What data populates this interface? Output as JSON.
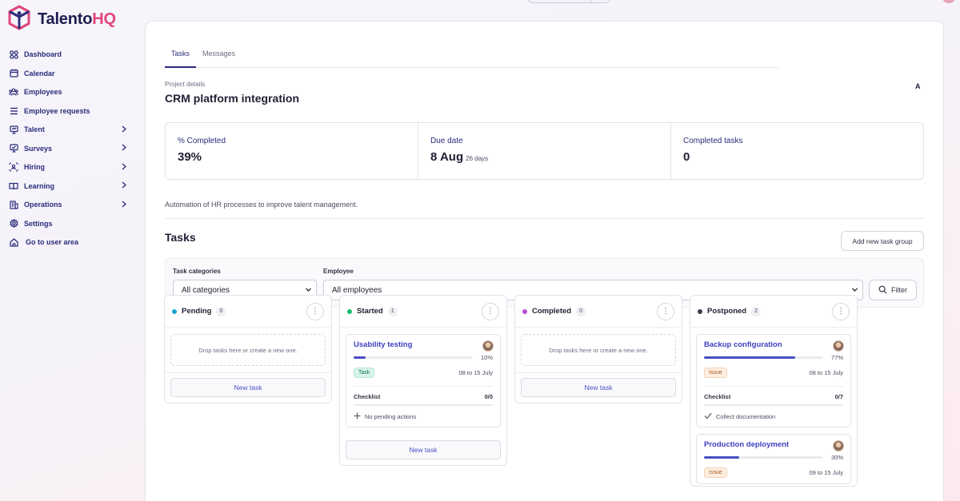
{
  "brand": {
    "name_main": "Talento",
    "name_accent": "HQ",
    "accent_color": "#e0457b",
    "primary_color": "#2a2c7a"
  },
  "sidebar": {
    "items": [
      {
        "label": "Dashboard",
        "icon": "grid-icon",
        "chevron": false
      },
      {
        "label": "Calendar",
        "icon": "calendar-icon",
        "chevron": false
      },
      {
        "label": "Employees",
        "icon": "users-icon",
        "chevron": false
      },
      {
        "label": "Employee requests",
        "icon": "list-icon",
        "chevron": false
      },
      {
        "label": "Talent",
        "icon": "presentation-icon",
        "chevron": true
      },
      {
        "label": "Surveys",
        "icon": "survey-icon",
        "chevron": true
      },
      {
        "label": "Hiring",
        "icon": "hiring-icon",
        "chevron": true
      },
      {
        "label": "Learning",
        "icon": "book-icon",
        "chevron": true
      },
      {
        "label": "Operations",
        "icon": "building-icon",
        "chevron": true
      },
      {
        "label": "Settings",
        "icon": "gear-icon",
        "chevron": false
      },
      {
        "label": "Go to user area",
        "icon": "home-icon",
        "chevron": false
      }
    ]
  },
  "tabs": [
    {
      "label": "Tasks",
      "active": true
    },
    {
      "label": "Messages",
      "active": false
    }
  ],
  "project": {
    "label": "Project details",
    "title": "CRM platform integration",
    "avatar_letter": "A",
    "description": "Automation of HR processes to improve talent management."
  },
  "stats": {
    "completed": {
      "label": "% Completed",
      "value": "39%"
    },
    "due": {
      "label": "Due date",
      "value": "8 Aug",
      "sub": "26 days"
    },
    "tasks_done": {
      "label": "Completed tasks",
      "value": "0"
    }
  },
  "tasks": {
    "title": "Tasks",
    "add_group_label": "Add new task group",
    "filters": {
      "category_label": "Task categories",
      "category_value": "All categories",
      "employee_label": "Employee",
      "employee_value": "All employees",
      "filter_label": "Filter"
    }
  },
  "columns": {
    "pending": {
      "title": "Pending",
      "count": "0",
      "color": "#1ba6d6",
      "drop_text": "Drop tasks here or create a new one.",
      "new_task": "New task"
    },
    "started": {
      "title": "Started",
      "count": "1",
      "color": "#19b86e",
      "new_task": "New task",
      "cards": [
        {
          "title": "Usability testing",
          "progress": 10,
          "progress_label": "10%",
          "tag": "Task",
          "dates": "08 to 15 July",
          "checklist_label": "Checklist",
          "checklist_count": "0/0",
          "checklist_item": "No pending actions"
        }
      ]
    },
    "completed": {
      "title": "Completed",
      "count": "0",
      "color": "#b84fd6",
      "drop_text": "Drop tasks here or create a new one.",
      "new_task": "New task"
    },
    "postponed": {
      "title": "Postponed",
      "count": "2",
      "color": "#3a3b4a",
      "cards": [
        {
          "title": "Backup configuration",
          "progress": 77,
          "progress_label": "77%",
          "tag": "Issue",
          "dates": "08 to 15 July",
          "checklist_label": "Checklist",
          "checklist_count": "0/7",
          "checklist_item": "Collect documentation"
        },
        {
          "title": "Production deployment",
          "progress": 30,
          "progress_label": "30%",
          "tag": "Issue",
          "dates": "09 to 15 July"
        }
      ]
    }
  }
}
